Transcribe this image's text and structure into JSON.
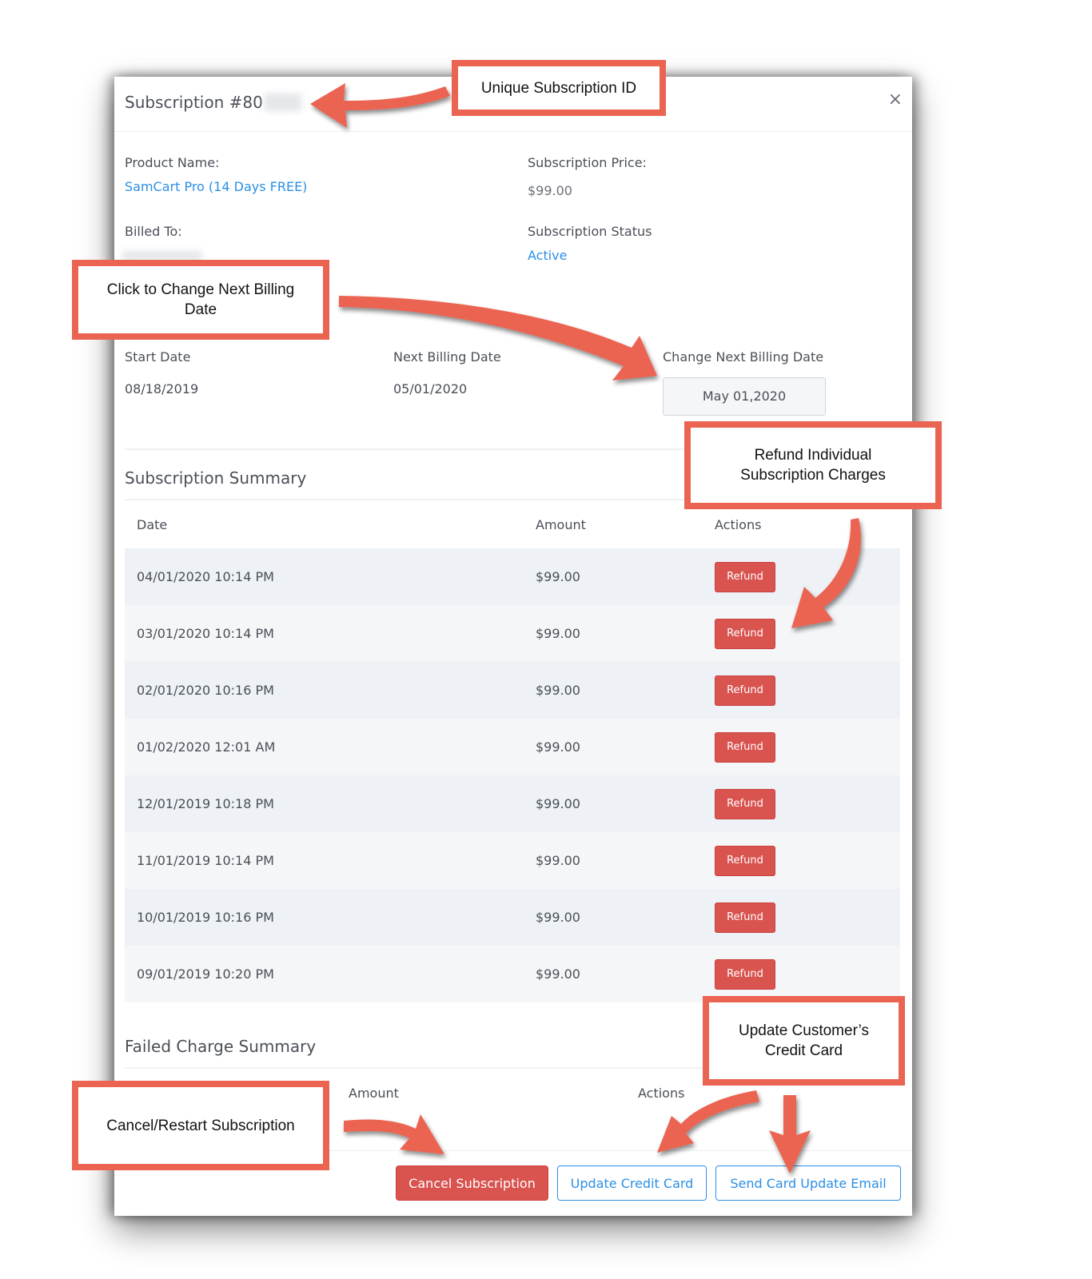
{
  "modal": {
    "title_prefix": "Subscription #80",
    "close_icon": "×",
    "product_name_label": "Product Name:",
    "product_name": "SamCart Pro (14 Days FREE)",
    "price_label": "Subscription Price:",
    "price": "$99.00",
    "billed_to_label": "Billed To:",
    "status_label": "Subscription Status",
    "status": "Active",
    "start_date_label": "Start Date",
    "start_date": "08/18/2019",
    "next_billing_label": "Next Billing Date",
    "next_billing": "05/01/2020",
    "change_billing_label": "Change Next Billing Date",
    "change_billing_value": "May 01,2020"
  },
  "subscription_summary": {
    "title": "Subscription Summary",
    "columns": [
      "Date",
      "Amount",
      "Actions"
    ],
    "rows": [
      {
        "date": "04/01/2020 10:14 PM",
        "amount": "$99.00",
        "action": "Refund"
      },
      {
        "date": "03/01/2020 10:14 PM",
        "amount": "$99.00",
        "action": "Refund"
      },
      {
        "date": "02/01/2020 10:16 PM",
        "amount": "$99.00",
        "action": "Refund"
      },
      {
        "date": "01/02/2020 12:01 AM",
        "amount": "$99.00",
        "action": "Refund"
      },
      {
        "date": "12/01/2019 10:18 PM",
        "amount": "$99.00",
        "action": "Refund"
      },
      {
        "date": "11/01/2019 10:14 PM",
        "amount": "$99.00",
        "action": "Refund"
      },
      {
        "date": "10/01/2019 10:16 PM",
        "amount": "$99.00",
        "action": "Refund"
      },
      {
        "date": "09/01/2019 10:20 PM",
        "amount": "$99.00",
        "action": "Refund"
      }
    ]
  },
  "failed_charge_summary": {
    "title": "Failed Charge Summary",
    "columns": [
      "Amount",
      "Actions"
    ]
  },
  "footer": {
    "cancel_label": "Cancel Subscription",
    "update_card_label": "Update Credit Card",
    "send_email_label": "Send Card Update Email"
  },
  "annotations": {
    "unique_id": "Unique Subscription ID",
    "change_billing_line1": "Click to Change Next Billing",
    "change_billing_line2": "Date",
    "refund_line1": "Refund Individual",
    "refund_line2": "Subscription Charges",
    "update_card_line1": "Update Customer’s",
    "update_card_line2": "Credit Card",
    "cancel_restart": "Cancel/Restart Subscription"
  },
  "colors": {
    "accent_blue": "#2b8fe6",
    "danger_red": "#d9534f",
    "annotation_red": "#eb6451"
  }
}
